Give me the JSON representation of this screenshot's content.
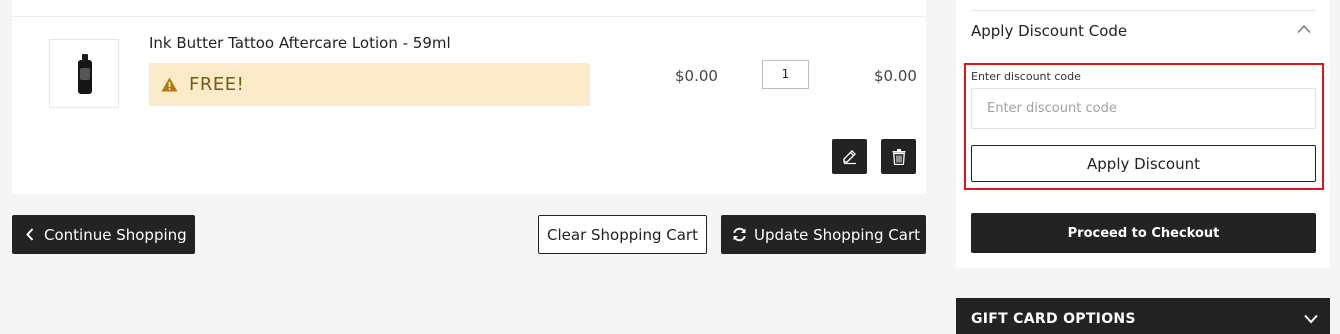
{
  "cart": {
    "item": {
      "name": "Ink Butter Tattoo Aftercare Lotion - 59ml",
      "notice": "FREE!",
      "price": "$0.00",
      "qty": "1",
      "subtotal": "$0.00"
    },
    "actions": {
      "continue_label": "Continue Shopping",
      "clear_label": "Clear Shopping Cart",
      "update_label": "Update Shopping Cart"
    }
  },
  "summary": {
    "discount": {
      "title": "Apply Discount Code",
      "field_label": "Enter discount code",
      "placeholder": "Enter discount code",
      "value": "",
      "apply_label": "Apply Discount"
    },
    "checkout_label": "Proceed to Checkout"
  },
  "gift": {
    "title": "GIFT CARD OPTIONS"
  },
  "colors": {
    "dark_button": "#232323",
    "notice_bg": "#fcebc9",
    "notice_icon": "#b07a10",
    "highlight_border": "#e0141b"
  },
  "icons": [
    "bottle-image",
    "warning-icon",
    "edit-icon",
    "trash-icon",
    "chevron-left-icon",
    "refresh-icon",
    "chevron-up-icon",
    "chevron-down-icon"
  ]
}
